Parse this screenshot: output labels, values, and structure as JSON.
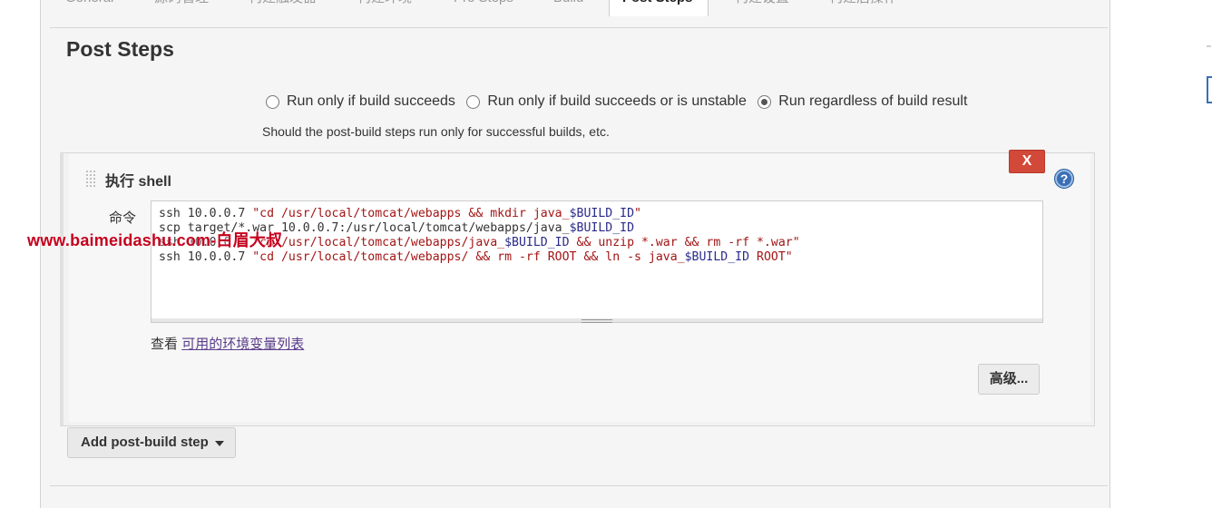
{
  "tabs": [
    {
      "label": "General"
    },
    {
      "label": "源码管理"
    },
    {
      "label": "构建触发器"
    },
    {
      "label": "构建环境"
    },
    {
      "label": "Pre Steps"
    },
    {
      "label": "Build"
    },
    {
      "label": "Post Steps"
    },
    {
      "label": "构建设置"
    },
    {
      "label": "构建后操作"
    }
  ],
  "active_tab": "Post Steps",
  "section": {
    "title": "Post Steps",
    "radios": [
      {
        "label": "Run only if build succeeds",
        "checked": false
      },
      {
        "label": "Run only if build succeeds or is unstable",
        "checked": false
      },
      {
        "label": "Run regardless of build result",
        "checked": true
      }
    ],
    "hint": "Should the post-build steps run only for successful builds, etc."
  },
  "build_step": {
    "title": "执行 shell",
    "delete_label": "X",
    "help_icon": "help-icon",
    "command_label": "命令",
    "command_lines": [
      "ssh 10.0.0.7 \"cd /usr/local/tomcat/webapps && mkdir java_$BUILD_ID\"",
      "scp target/*.war 10.0.0.7:/usr/local/tomcat/webapps/java_$BUILD_ID",
      "ssh 10.0.0.7 \"cd /usr/local/tomcat/webapps/java_$BUILD_ID && unzip *.war && rm -rf *.war\"",
      "ssh 10.0.0.7 \"cd /usr/local/tomcat/webapps/ && rm -rf ROOT && ln -s java_$BUILD_ID ROOT\""
    ],
    "env_prefix": "查看",
    "env_link": "可用的环境变量列表",
    "advanced_label": "高级..."
  },
  "add_step_label": "Add post-build step",
  "watermark": "www.baimeidashu.com-白眉大叔",
  "colors": {
    "delete": "#d24939",
    "help": "#3a6fb5",
    "link": "#5a3c8a",
    "watermark": "#c4001d"
  }
}
